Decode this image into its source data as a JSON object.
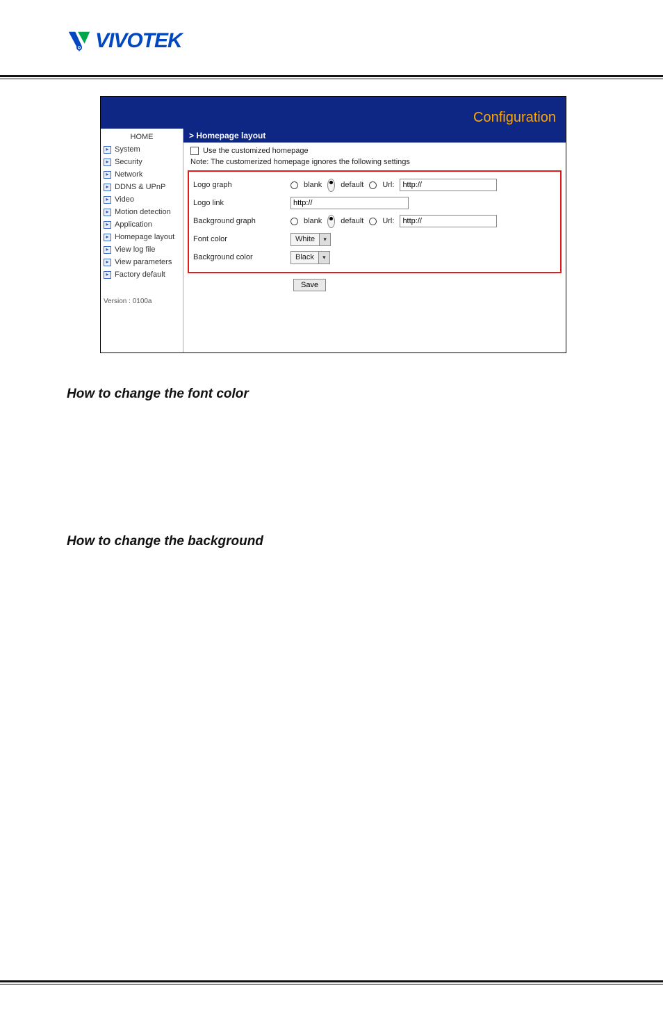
{
  "logo": {
    "text": "VIVOTEK"
  },
  "config": {
    "title": "Configuration",
    "section_title": "> Homepage layout",
    "use_customized_label": "Use the customized homepage",
    "note": "Note: The customerized homepage ignores the following settings",
    "rows": {
      "logo_graph": "Logo graph",
      "logo_link": "Logo link",
      "background_graph": "Background graph",
      "font_color": "Font color",
      "background_color": "Background color"
    },
    "radio": {
      "blank": "blank",
      "default": "default",
      "url": "Url:"
    },
    "inputs": {
      "logo_graph_url": "http://",
      "logo_link": "http://",
      "background_url": "http://"
    },
    "selects": {
      "font_color": "White",
      "background_color": "Black"
    },
    "save_label": "Save"
  },
  "sidebar": {
    "home": "HOME",
    "items": [
      "System",
      "Security",
      "Network",
      "DDNS & UPnP",
      "Video",
      "Motion detection",
      "Application",
      "Homepage layout",
      "View log file",
      "View parameters",
      "Factory default"
    ],
    "version": "Version : 0100a"
  },
  "doc": {
    "heading1": "How to change the font color",
    "heading2": "How to change the background"
  }
}
